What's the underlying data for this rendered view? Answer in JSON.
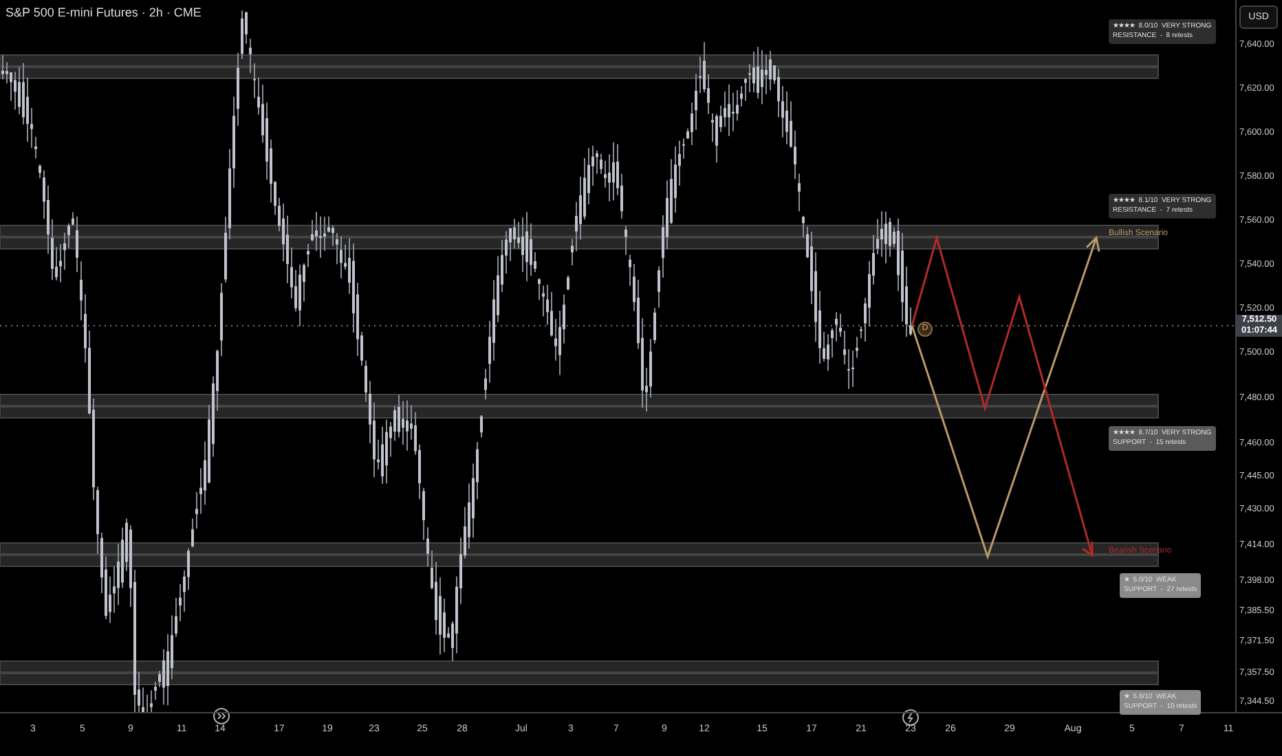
{
  "chart": {
    "title": "S&P 500 E-mini Futures · 2h · CME"
  },
  "zones": [
    {
      "kind": "resistance",
      "score": "★★★★  8.0/10  VERY STRONG",
      "detail": "RESISTANCE  -  8 retests"
    },
    {
      "kind": "resistance",
      "score": "★★★★  8.1/10  VERY STRONG",
      "detail": "RESISTANCE  -  7 retests"
    },
    {
      "kind": "support",
      "score": "★★★★  8.7/10  VERY STRONG",
      "detail": "SUPPORT  -  15 retests"
    },
    {
      "kind": "support",
      "score": "★  5.0/10  WEAK",
      "detail": "SUPPORT  -  27 retests"
    },
    {
      "kind": "support",
      "score": "★  5.8/10  WEAK",
      "detail": "SUPPORT  -  10 retests"
    }
  ],
  "scenarios": [
    {
      "kind": "bullish",
      "label": "Bullish Scenario"
    },
    {
      "kind": "bearish",
      "label": "Bearish Scenario"
    }
  ],
  "marker": "D",
  "price_axis": {
    "currency": "USD",
    "last_price": "7,512.50",
    "countdown": "01:07:44",
    "ticks": [
      "7,640.00",
      "7,620.00",
      "7,600.00",
      "7,580.00",
      "7,560.00",
      "7,540.00",
      "7,520.00",
      "7,500.00",
      "7,480.00",
      "7,460.00",
      "7,445.00",
      "7,430.00",
      "7,414.00",
      "7,398.00",
      "7,385.50",
      "7,371.50",
      "7,357.50",
      "7,344.50"
    ]
  },
  "time_axis": {
    "labels": [
      "3",
      "5",
      "9",
      "11",
      "14",
      "17",
      "19",
      "23",
      "25",
      "28",
      "Jul",
      "3",
      "7",
      "9",
      "12",
      "15",
      "17",
      "21",
      "23",
      "26",
      "29",
      "Aug",
      "5",
      "7",
      "11"
    ]
  }
}
